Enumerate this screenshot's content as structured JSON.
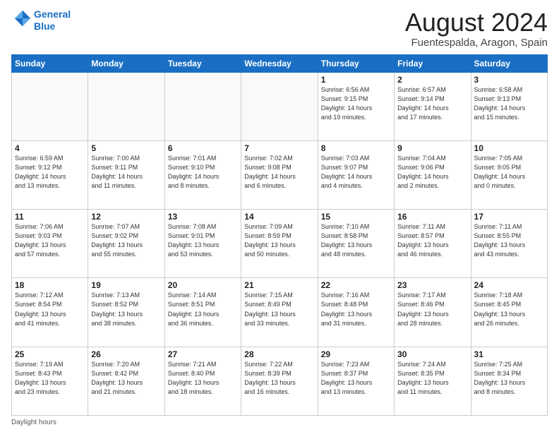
{
  "header": {
    "logo_line1": "General",
    "logo_line2": "Blue",
    "title": "August 2024",
    "subtitle": "Fuentespalda, Aragon, Spain"
  },
  "days_of_week": [
    "Sunday",
    "Monday",
    "Tuesday",
    "Wednesday",
    "Thursday",
    "Friday",
    "Saturday"
  ],
  "weeks": [
    [
      {
        "day": "",
        "info": ""
      },
      {
        "day": "",
        "info": ""
      },
      {
        "day": "",
        "info": ""
      },
      {
        "day": "",
        "info": ""
      },
      {
        "day": "1",
        "info": "Sunrise: 6:56 AM\nSunset: 9:15 PM\nDaylight: 14 hours\nand 19 minutes."
      },
      {
        "day": "2",
        "info": "Sunrise: 6:57 AM\nSunset: 9:14 PM\nDaylight: 14 hours\nand 17 minutes."
      },
      {
        "day": "3",
        "info": "Sunrise: 6:58 AM\nSunset: 9:13 PM\nDaylight: 14 hours\nand 15 minutes."
      }
    ],
    [
      {
        "day": "4",
        "info": "Sunrise: 6:59 AM\nSunset: 9:12 PM\nDaylight: 14 hours\nand 13 minutes."
      },
      {
        "day": "5",
        "info": "Sunrise: 7:00 AM\nSunset: 9:11 PM\nDaylight: 14 hours\nand 11 minutes."
      },
      {
        "day": "6",
        "info": "Sunrise: 7:01 AM\nSunset: 9:10 PM\nDaylight: 14 hours\nand 8 minutes."
      },
      {
        "day": "7",
        "info": "Sunrise: 7:02 AM\nSunset: 9:08 PM\nDaylight: 14 hours\nand 6 minutes."
      },
      {
        "day": "8",
        "info": "Sunrise: 7:03 AM\nSunset: 9:07 PM\nDaylight: 14 hours\nand 4 minutes."
      },
      {
        "day": "9",
        "info": "Sunrise: 7:04 AM\nSunset: 9:06 PM\nDaylight: 14 hours\nand 2 minutes."
      },
      {
        "day": "10",
        "info": "Sunrise: 7:05 AM\nSunset: 9:05 PM\nDaylight: 14 hours\nand 0 minutes."
      }
    ],
    [
      {
        "day": "11",
        "info": "Sunrise: 7:06 AM\nSunset: 9:03 PM\nDaylight: 13 hours\nand 57 minutes."
      },
      {
        "day": "12",
        "info": "Sunrise: 7:07 AM\nSunset: 9:02 PM\nDaylight: 13 hours\nand 55 minutes."
      },
      {
        "day": "13",
        "info": "Sunrise: 7:08 AM\nSunset: 9:01 PM\nDaylight: 13 hours\nand 53 minutes."
      },
      {
        "day": "14",
        "info": "Sunrise: 7:09 AM\nSunset: 8:59 PM\nDaylight: 13 hours\nand 50 minutes."
      },
      {
        "day": "15",
        "info": "Sunrise: 7:10 AM\nSunset: 8:58 PM\nDaylight: 13 hours\nand 48 minutes."
      },
      {
        "day": "16",
        "info": "Sunrise: 7:11 AM\nSunset: 8:57 PM\nDaylight: 13 hours\nand 46 minutes."
      },
      {
        "day": "17",
        "info": "Sunrise: 7:11 AM\nSunset: 8:55 PM\nDaylight: 13 hours\nand 43 minutes."
      }
    ],
    [
      {
        "day": "18",
        "info": "Sunrise: 7:12 AM\nSunset: 8:54 PM\nDaylight: 13 hours\nand 41 minutes."
      },
      {
        "day": "19",
        "info": "Sunrise: 7:13 AM\nSunset: 8:52 PM\nDaylight: 13 hours\nand 38 minutes."
      },
      {
        "day": "20",
        "info": "Sunrise: 7:14 AM\nSunset: 8:51 PM\nDaylight: 13 hours\nand 36 minutes."
      },
      {
        "day": "21",
        "info": "Sunrise: 7:15 AM\nSunset: 8:49 PM\nDaylight: 13 hours\nand 33 minutes."
      },
      {
        "day": "22",
        "info": "Sunrise: 7:16 AM\nSunset: 8:48 PM\nDaylight: 13 hours\nand 31 minutes."
      },
      {
        "day": "23",
        "info": "Sunrise: 7:17 AM\nSunset: 8:46 PM\nDaylight: 13 hours\nand 28 minutes."
      },
      {
        "day": "24",
        "info": "Sunrise: 7:18 AM\nSunset: 8:45 PM\nDaylight: 13 hours\nand 26 minutes."
      }
    ],
    [
      {
        "day": "25",
        "info": "Sunrise: 7:19 AM\nSunset: 8:43 PM\nDaylight: 13 hours\nand 23 minutes."
      },
      {
        "day": "26",
        "info": "Sunrise: 7:20 AM\nSunset: 8:42 PM\nDaylight: 13 hours\nand 21 minutes."
      },
      {
        "day": "27",
        "info": "Sunrise: 7:21 AM\nSunset: 8:40 PM\nDaylight: 13 hours\nand 18 minutes."
      },
      {
        "day": "28",
        "info": "Sunrise: 7:22 AM\nSunset: 8:39 PM\nDaylight: 13 hours\nand 16 minutes."
      },
      {
        "day": "29",
        "info": "Sunrise: 7:23 AM\nSunset: 8:37 PM\nDaylight: 13 hours\nand 13 minutes."
      },
      {
        "day": "30",
        "info": "Sunrise: 7:24 AM\nSunset: 8:35 PM\nDaylight: 13 hours\nand 11 minutes."
      },
      {
        "day": "31",
        "info": "Sunrise: 7:25 AM\nSunset: 8:34 PM\nDaylight: 13 hours\nand 8 minutes."
      }
    ]
  ],
  "footer": {
    "note": "Daylight hours"
  }
}
